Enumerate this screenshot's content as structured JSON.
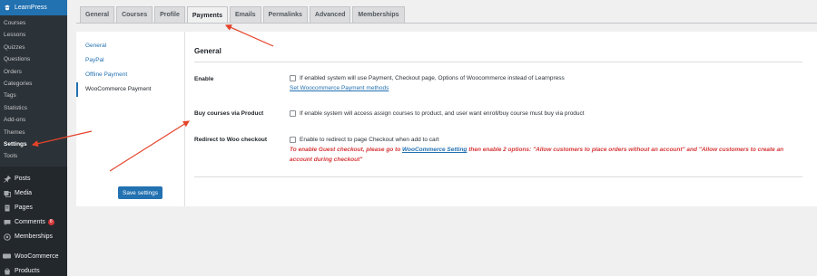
{
  "sidebar": {
    "brand": "LearnPress",
    "sub_items": [
      "Courses",
      "Lessons",
      "Quizzes",
      "Questions",
      "Orders",
      "Categories",
      "Tags",
      "Statistics",
      "Add-ons",
      "Themes",
      "Settings",
      "Tools"
    ],
    "active_sub": "Settings",
    "menu": [
      {
        "label": "Posts",
        "icon": "pin-icon"
      },
      {
        "label": "Media",
        "icon": "media-icon"
      },
      {
        "label": "Pages",
        "icon": "pages-icon"
      },
      {
        "label": "Comments",
        "icon": "comments-icon",
        "badge": "8"
      },
      {
        "label": "Memberships",
        "icon": "memberships-icon"
      },
      {
        "label": "WooCommerce",
        "icon": "woo-icon"
      },
      {
        "label": "Products",
        "icon": "products-icon"
      }
    ]
  },
  "tabs": [
    "General",
    "Courses",
    "Profile",
    "Payments",
    "Emails",
    "Permalinks",
    "Advanced",
    "Memberships"
  ],
  "active_tab": "Payments",
  "left_nav": [
    "General",
    "PayPal",
    "Offline Payment",
    "WooCommerce Payment"
  ],
  "active_left_nav": "WooCommerce Payment",
  "section_title": "General",
  "rows": {
    "enable": {
      "label": "Enable",
      "text": "If enabled system will use Payment, Checkout page, Options of Woocommerce instead of Learnpress",
      "link": "Set Woocommerce Payment methods"
    },
    "buy": {
      "label": "Buy courses via Product",
      "text": "If enable system will access assign courses to product, and user want enroll/buy course must buy via product"
    },
    "redirect": {
      "label": "Redirect to Woo checkout",
      "text": "Enable to redirect to page Checkout when add to cart",
      "note_before": "To enable Guest checkout, please go to ",
      "note_link": "WooCommerce Setting",
      "note_after": " then enable 2 options: \"Allow customers to place orders without an account\" and \"Allow customers to create an account during checkout\""
    }
  },
  "save_label": "Save settings",
  "colors": {
    "primary": "#2271b1",
    "arrow": "#e5432a",
    "sidebar": "#23282d",
    "note": "#d63638"
  }
}
